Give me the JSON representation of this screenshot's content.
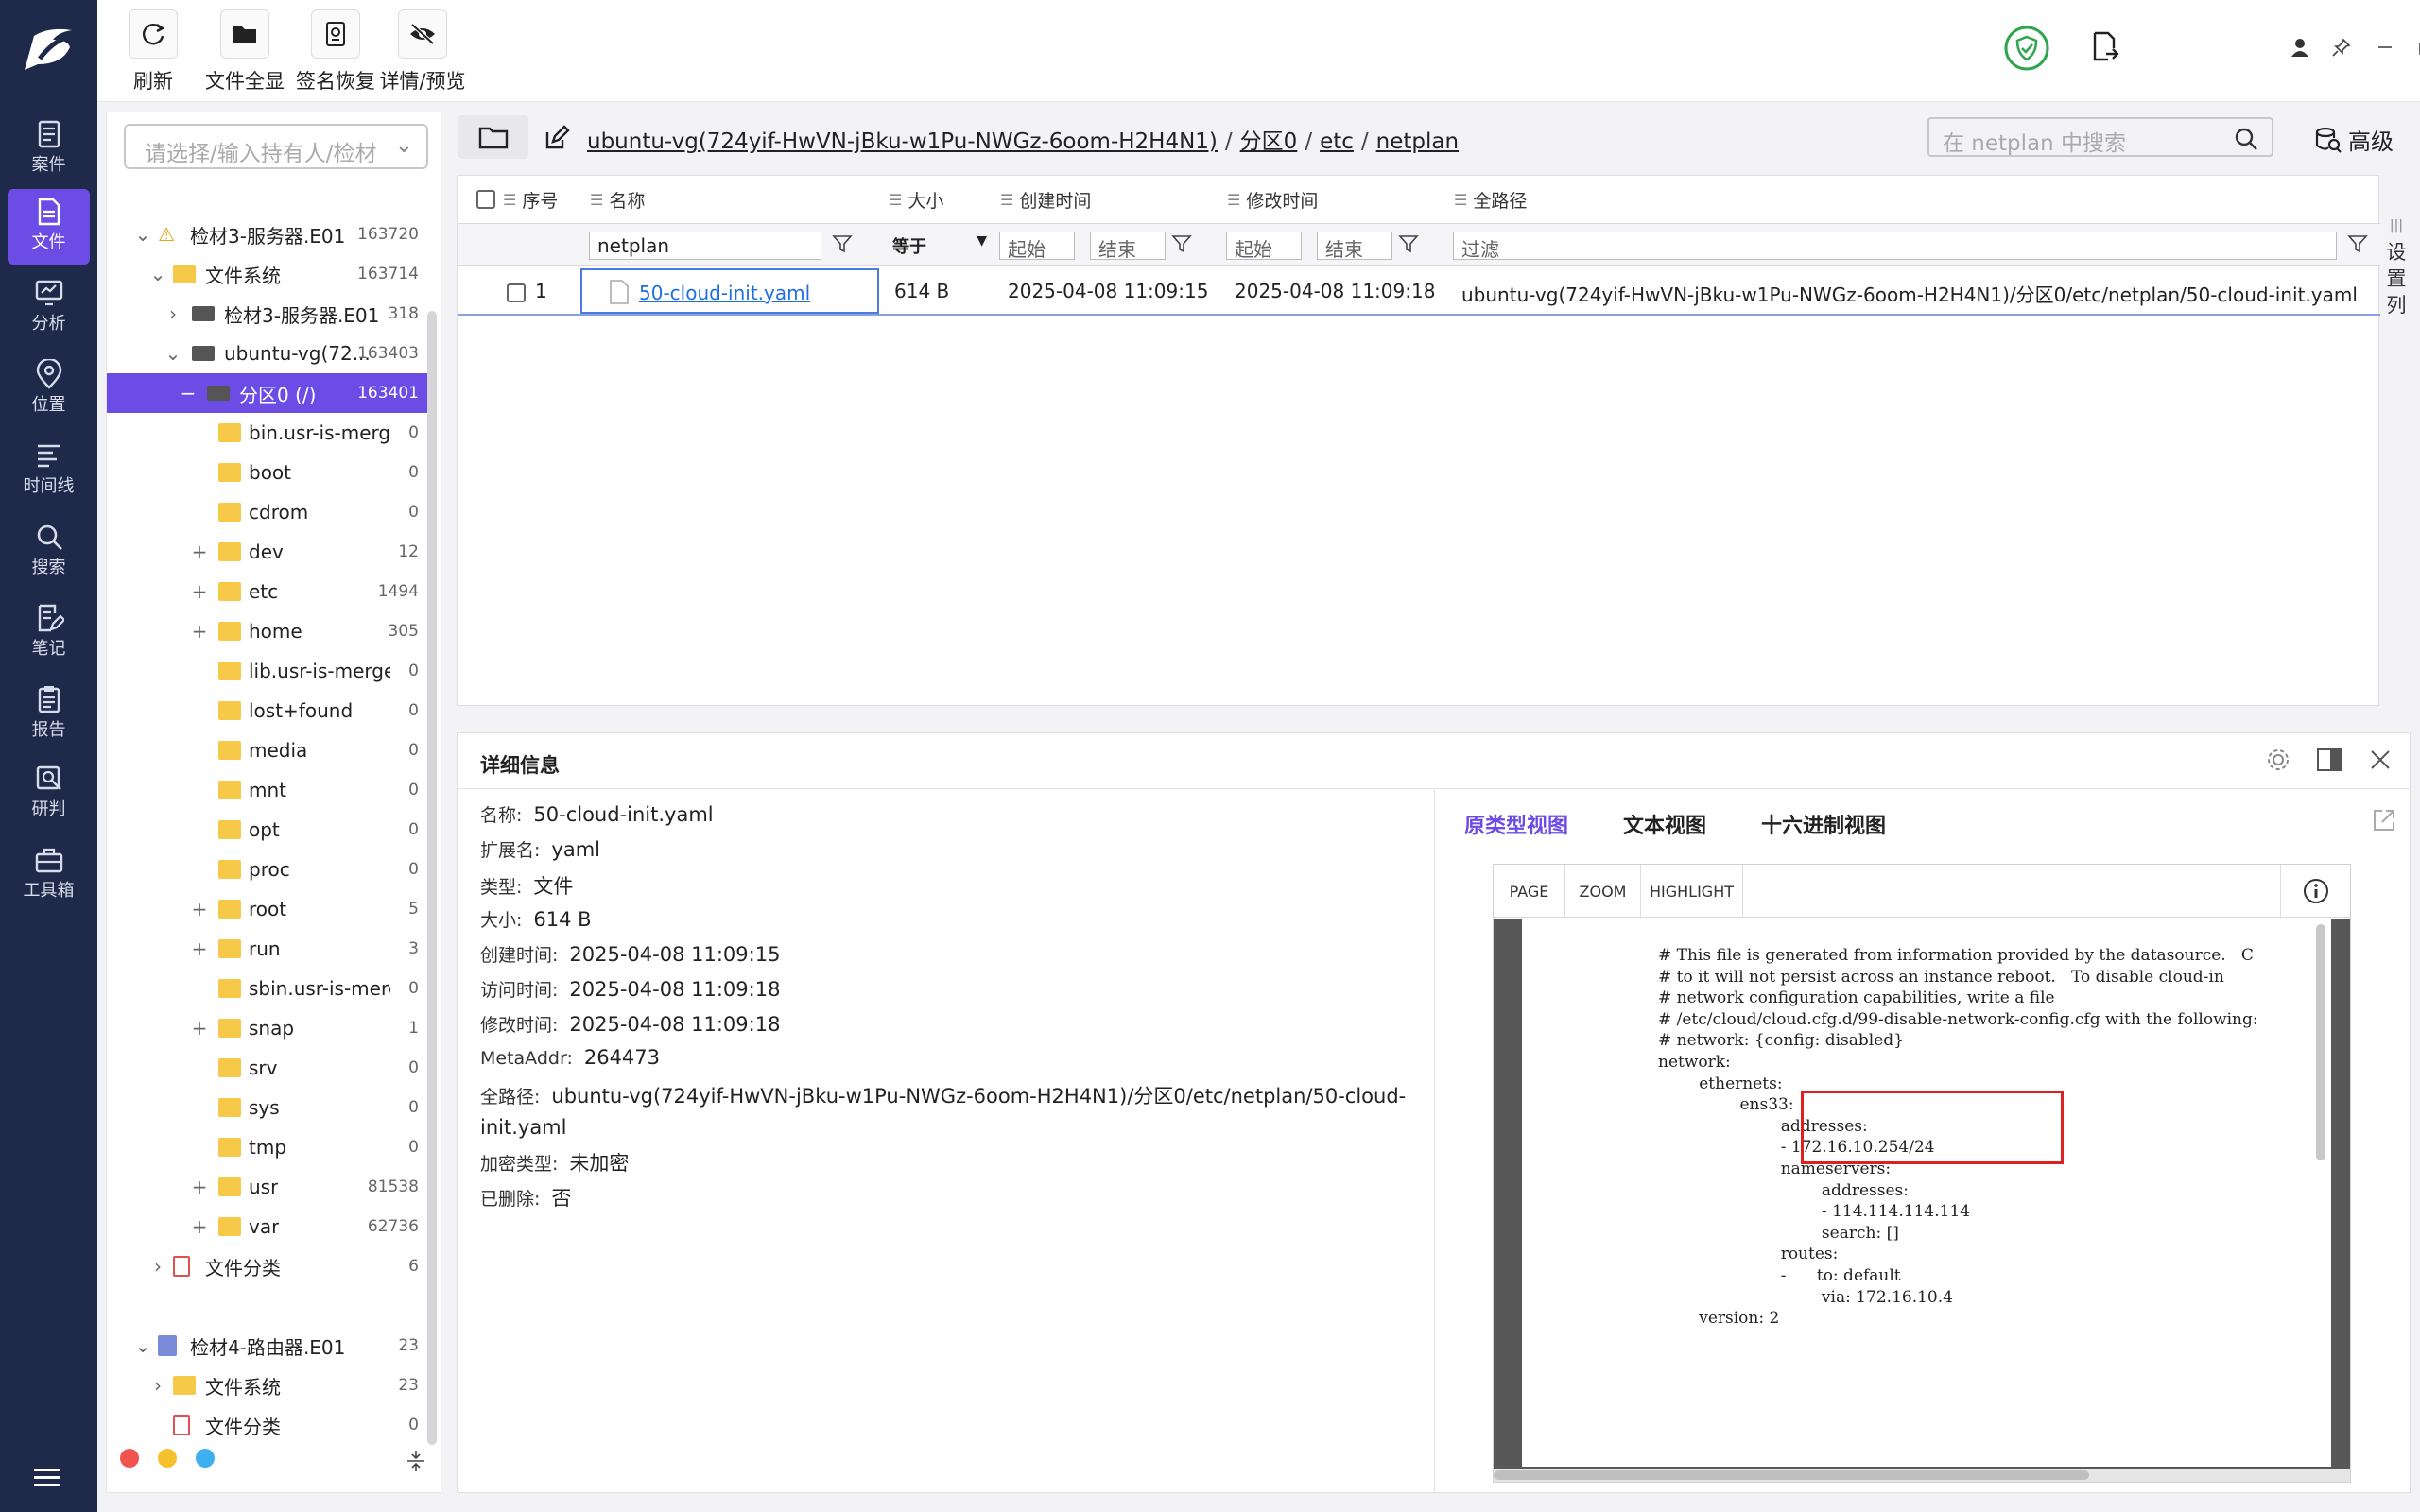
{
  "toolbar": {
    "refresh": "刷新",
    "show_all": "文件全显",
    "signature": "签名恢复",
    "preview": "详情/预览"
  },
  "nav": [
    {
      "label": "案件",
      "icon": "case-icon"
    },
    {
      "label": "文件",
      "icon": "file-icon"
    },
    {
      "label": "分析",
      "icon": "analysis-icon"
    },
    {
      "label": "位置",
      "icon": "location-icon"
    },
    {
      "label": "时间线",
      "icon": "timeline-icon"
    },
    {
      "label": "搜索",
      "icon": "search-icon"
    },
    {
      "label": "笔记",
      "icon": "note-icon"
    },
    {
      "label": "报告",
      "icon": "report-icon"
    },
    {
      "label": "研判",
      "icon": "judge-icon"
    },
    {
      "label": "工具箱",
      "icon": "toolbox-icon"
    }
  ],
  "tree": {
    "placeholder": "请选择/输入持有人/检材",
    "rows": [
      {
        "label": "检材3-服务器.E01",
        "count": "163720",
        "exp": "⌄"
      },
      {
        "label": "文件系统",
        "count": "163714",
        "exp": "⌄"
      },
      {
        "label": "检材3-服务器.E01",
        "count": "318",
        "exp": "›"
      },
      {
        "label": "ubuntu-vg(72...",
        "count": "163403",
        "exp": "⌄"
      },
      {
        "label": "分区0 (/)",
        "count": "163401",
        "exp": "−"
      },
      {
        "label": "bin.usr-is-merged",
        "count": "0",
        "exp": ""
      },
      {
        "label": "boot",
        "count": "0",
        "exp": ""
      },
      {
        "label": "cdrom",
        "count": "0",
        "exp": ""
      },
      {
        "label": "dev",
        "count": "12",
        "exp": "+"
      },
      {
        "label": "etc",
        "count": "1494",
        "exp": "+"
      },
      {
        "label": "home",
        "count": "305",
        "exp": "+"
      },
      {
        "label": "lib.usr-is-merged",
        "count": "0",
        "exp": ""
      },
      {
        "label": "lost+found",
        "count": "0",
        "exp": ""
      },
      {
        "label": "media",
        "count": "0",
        "exp": ""
      },
      {
        "label": "mnt",
        "count": "0",
        "exp": ""
      },
      {
        "label": "opt",
        "count": "0",
        "exp": ""
      },
      {
        "label": "proc",
        "count": "0",
        "exp": ""
      },
      {
        "label": "root",
        "count": "5",
        "exp": "+"
      },
      {
        "label": "run",
        "count": "3",
        "exp": "+"
      },
      {
        "label": "sbin.usr-is-merg...",
        "count": "0",
        "exp": ""
      },
      {
        "label": "snap",
        "count": "1",
        "exp": "+"
      },
      {
        "label": "srv",
        "count": "0",
        "exp": ""
      },
      {
        "label": "sys",
        "count": "0",
        "exp": ""
      },
      {
        "label": "tmp",
        "count": "0",
        "exp": ""
      },
      {
        "label": "usr",
        "count": "81538",
        "exp": "+"
      },
      {
        "label": "var",
        "count": "62736",
        "exp": "+"
      },
      {
        "label": "文件分类",
        "count": "6",
        "exp": "›"
      },
      {
        "label": "检材4-路由器.E01",
        "count": "23",
        "exp": "⌄"
      },
      {
        "label": "文件系统",
        "count": "23",
        "exp": "›"
      },
      {
        "label": "文件分类",
        "count": "0",
        "exp": ""
      }
    ]
  },
  "pathbar": {
    "crumbs": [
      "ubuntu-vg(724yif-HwVN-jBku-w1Pu-NWGz-6oom-H2H4N1)",
      "分区0",
      "etc",
      "netplan"
    ],
    "search_placeholder": "在 netplan 中搜索",
    "advanced": "高级"
  },
  "grid": {
    "headers": {
      "seq": "序号",
      "name": "名称",
      "size": "大小",
      "created": "创建时间",
      "modified": "修改时间",
      "fullpath": "全路径"
    },
    "filters": {
      "name": "netplan",
      "size_op": "等于",
      "start": "起始",
      "end": "结束",
      "path": "过滤"
    },
    "settings": "设置列",
    "rows": [
      {
        "seq": "1",
        "name": "50-cloud-init.yaml",
        "size": "614 B",
        "created": "2025-04-08 11:09:15",
        "modified": "2025-04-08 11:09:18",
        "path": "ubuntu-vg(724yif-HwVN-jBku-w1Pu-NWGz-6oom-H2H4N1)/分区0/etc/netplan/50-cloud-init.yaml"
      }
    ]
  },
  "detail": {
    "title": "详细信息",
    "props": [
      {
        "k": "名称:",
        "v": "50-cloud-init.yaml"
      },
      {
        "k": "扩展名:",
        "v": "yaml"
      },
      {
        "k": "类型:",
        "v": "文件"
      },
      {
        "k": "大小:",
        "v": "614 B"
      },
      {
        "k": "创建时间:",
        "v": "2025-04-08 11:09:15"
      },
      {
        "k": "访问时间:",
        "v": "2025-04-08 11:09:18"
      },
      {
        "k": "修改时间:",
        "v": "2025-04-08 11:09:18"
      },
      {
        "k": "MetaAddr:",
        "v": "264473"
      },
      {
        "k": "全路径:",
        "v": "ubuntu-vg(724yif-HwVN-jBku-w1Pu-NWGz-6oom-H2H4N1)/分区0/etc/netplan/50-cloud-init.yaml"
      },
      {
        "k": "加密类型:",
        "v": "未加密"
      },
      {
        "k": "已删除:",
        "v": "否"
      }
    ],
    "tabs": [
      "原类型视图",
      "文本视图",
      "十六进制视图"
    ],
    "viewer_buttons": [
      "PAGE",
      "ZOOM",
      "HIGHLIGHT"
    ],
    "code": "# This file is generated from information provided by the datasource.   C\n# to it will not persist across an instance reboot.   To disable cloud-in\n# network configuration capabilities, write a file\n# /etc/cloud/cloud.cfg.d/99-disable-network-config.cfg with the following:\n# network: {config: disabled}\nnetwork:\n        ethernets:\n                ens33:\n                        addresses:\n                        - 172.16.10.254/24\n                        nameservers:\n                                addresses:\n                                - 114.114.114.114\n                                search: []\n                        routes:\n                        -      to: default\n                                via: 172.16.10.4\n        version: 2"
  },
  "colors": {
    "accent": "#6b4de6",
    "nav_bg": "#1f2a4a",
    "link": "#1f6fe0",
    "highlight_box": "#e02020"
  }
}
